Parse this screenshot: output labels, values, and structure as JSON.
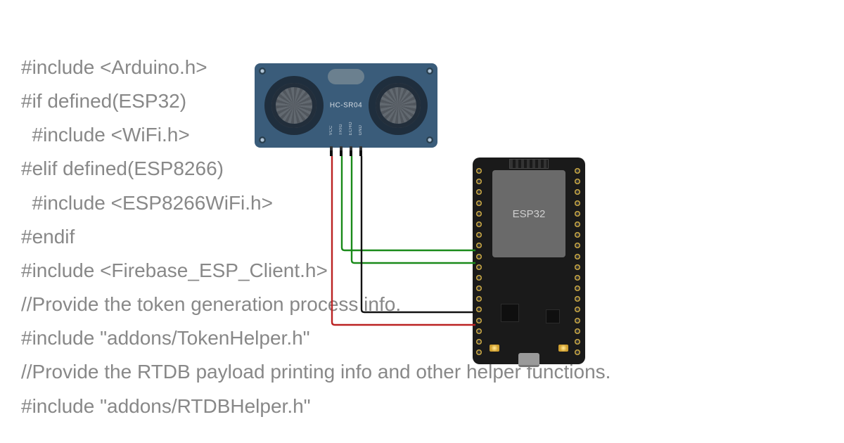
{
  "code": {
    "l1": "#include <Arduino.h>",
    "l2": "#if defined(ESP32)",
    "l3": "  #include <WiFi.h>",
    "l4": "#elif defined(ESP8266)",
    "l5": "  #include <ESP8266WiFi.h>",
    "l6": "#endif",
    "l7": "#include <Firebase_ESP_Client.h>",
    "l8": "",
    "l9": "//Provide the token generation process info.",
    "l10": "#include \"addons/TokenHelper.h\"",
    "l11": "//Provide the RTDB payload printing info and other helper functions.",
    "l12": "#include \"addons/RTDBHelper.h\""
  },
  "sensor": {
    "model": "HC-SR04",
    "pins": {
      "p1": "VCC",
      "p2": "TRIG",
      "p3": "ECHO",
      "p4": "GND"
    }
  },
  "board": {
    "label": "ESP32"
  },
  "wires": {
    "vcc_color": "#bb2222",
    "trig_color": "#1a8a1a",
    "echo_color": "#1a8a1a",
    "gnd_color": "#111111"
  },
  "connections": [
    {
      "from": "HC-SR04 VCC",
      "to": "ESP32 5V",
      "color": "red"
    },
    {
      "from": "HC-SR04 TRIG",
      "to": "ESP32 GPIO",
      "color": "green"
    },
    {
      "from": "HC-SR04 ECHO",
      "to": "ESP32 GPIO",
      "color": "green"
    },
    {
      "from": "HC-SR04 GND",
      "to": "ESP32 GND",
      "color": "black"
    }
  ]
}
